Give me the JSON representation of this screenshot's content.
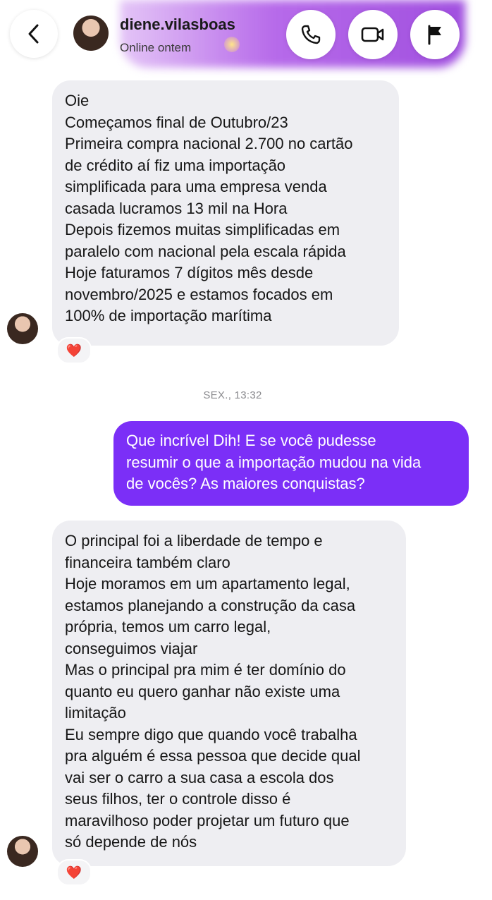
{
  "header": {
    "contact_name": "diene.vilasboas",
    "status": "Online ontem",
    "icons": {
      "back": "chevron-left-icon",
      "call": "phone-icon",
      "video": "video-camera-icon",
      "report": "flag-icon"
    },
    "accent_gradient": [
      "#ce96f0",
      "#9a3cdc"
    ]
  },
  "messages": [
    {
      "sender": "incoming",
      "lines": [
        "Oie",
        "Começamos final de Outubro/23",
        "Primeira compra nacional 2.700 no cartão",
        "de crédito aí fiz uma importação",
        "simplificada para uma empresa venda",
        "casada lucramos 13 mil na Hora",
        "Depois fizemos muitas simplificadas em",
        "paralelo com nacional pela escala rápida",
        "Hoje faturamos 7 dígitos mês desde",
        "novembro/2025 e estamos focados em",
        "100% de importação marítima"
      ],
      "reaction": "❤️"
    },
    {
      "sender": "outgoing",
      "lines": [
        "Que incrível Dih! E se você pudesse",
        "resumir o que a importação mudou na vida",
        "de vocês? As maiores conquistas?"
      ]
    },
    {
      "sender": "incoming",
      "lines": [
        "O principal foi a liberdade de tempo e",
        "financeira também claro",
        "Hoje moramos em um apartamento legal,",
        "estamos planejando a construção da casa",
        "própria, temos um carro legal,",
        "conseguimos viajar",
        "Mas o principal pra mim é ter domínio do",
        "quanto eu quero ganhar não existe uma",
        "limitação",
        "Eu sempre digo que quando você trabalha",
        "pra alguém é essa pessoa que decide qual",
        "vai ser o carro a sua casa a escola dos",
        "seus filhos, ter o controle disso é",
        "maravilhoso poder projetar um futuro que",
        "só depende de nós"
      ],
      "reaction": "❤️"
    }
  ],
  "timestamp": "SEX., 13:32",
  "colors": {
    "incoming_bubble": "#eeeef2",
    "outgoing_bubble": "#7b2ff7",
    "reaction_heart": "#e0202c"
  }
}
